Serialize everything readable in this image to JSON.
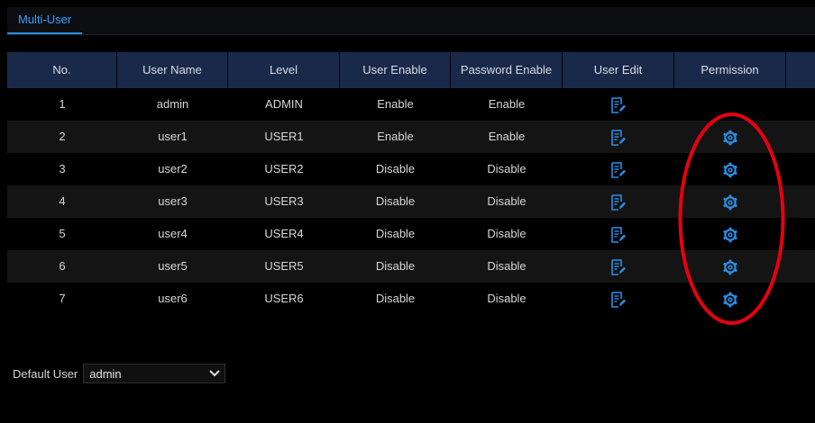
{
  "tab": {
    "label": "Multi-User"
  },
  "table": {
    "headers": [
      "No.",
      "User Name",
      "Level",
      "User Enable",
      "Password Enable",
      "User Edit",
      "Permission",
      ""
    ],
    "rows": [
      {
        "no": "1",
        "name": "admin",
        "level": "ADMIN",
        "user_enable": "Enable",
        "password_enable": "Enable",
        "has_permission": false
      },
      {
        "no": "2",
        "name": "user1",
        "level": "USER1",
        "user_enable": "Enable",
        "password_enable": "Enable",
        "has_permission": true
      },
      {
        "no": "3",
        "name": "user2",
        "level": "USER2",
        "user_enable": "Disable",
        "password_enable": "Disable",
        "has_permission": true
      },
      {
        "no": "4",
        "name": "user3",
        "level": "USER3",
        "user_enable": "Disable",
        "password_enable": "Disable",
        "has_permission": true
      },
      {
        "no": "5",
        "name": "user4",
        "level": "USER4",
        "user_enable": "Disable",
        "password_enable": "Disable",
        "has_permission": true
      },
      {
        "no": "6",
        "name": "user5",
        "level": "USER5",
        "user_enable": "Disable",
        "password_enable": "Disable",
        "has_permission": true
      },
      {
        "no": "7",
        "name": "user6",
        "level": "USER6",
        "user_enable": "Disable",
        "password_enable": "Disable",
        "has_permission": true
      }
    ]
  },
  "default_user": {
    "label": "Default User",
    "selected": "admin"
  },
  "icons": {
    "edit": "edit-icon",
    "permission": "gear-icon",
    "dropdown": "chevron-down-icon"
  },
  "colors": {
    "accent": "#2a8fe6",
    "header_bg": "#19294a",
    "annotation": "#e60012"
  }
}
